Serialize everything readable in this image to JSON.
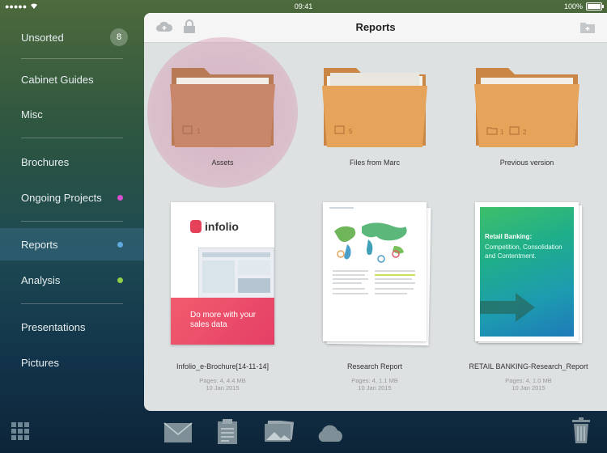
{
  "status": {
    "time": "09:41",
    "battery": "100%"
  },
  "sidebar": {
    "items": [
      {
        "label": "Unsorted",
        "badge": "8"
      },
      {
        "label": "Cabinet Guides"
      },
      {
        "label": "Misc"
      },
      {
        "label": "Brochures"
      },
      {
        "label": "Ongoing Projects",
        "dot": "#d84fd0"
      },
      {
        "label": "Reports",
        "dot": "#5da9dc"
      },
      {
        "label": "Analysis",
        "dot": "#8fcf4a"
      },
      {
        "label": "Presentations"
      },
      {
        "label": "Pictures"
      }
    ]
  },
  "panel": {
    "title": "Reports",
    "folders": [
      {
        "name": "Assets",
        "counts": [
          "1"
        ]
      },
      {
        "name": "Files from Marc",
        "counts": [
          "5"
        ]
      },
      {
        "name": "Previous version",
        "counts": [
          "1",
          "2"
        ]
      }
    ],
    "documents": [
      {
        "name": "Infolio_e-Brochure[14-11-14]",
        "pages": "Pages: 4, 4.4 MB",
        "date": "10 Jan 2015",
        "cover_brand": "infolio",
        "cover_tagline": "Do more with your sales data"
      },
      {
        "name": "Research Report",
        "pages": "Pages: 4, 1.1 MB",
        "date": "10 Jan 2015"
      },
      {
        "name": "RETAIL BANKING-Research_Report",
        "pages": "Pages: 4, 1.0 MB",
        "date": "10 Jan 2015",
        "cover_title": "Retail Banking:",
        "cover_subtitle": "Competition, Consolidation and Contentment."
      }
    ]
  },
  "icons": {
    "header": [
      "cloud-add-icon",
      "lock-icon",
      "new-folder-icon"
    ],
    "bottom": [
      "grid-icon",
      "mail-icon",
      "clipboard-icon",
      "photos-icon",
      "cloud-icon",
      "trash-icon"
    ]
  },
  "colors": {
    "folder": "#e6a35a",
    "folder_dark": "#c98645",
    "accent_pink": "#d84fd0"
  }
}
